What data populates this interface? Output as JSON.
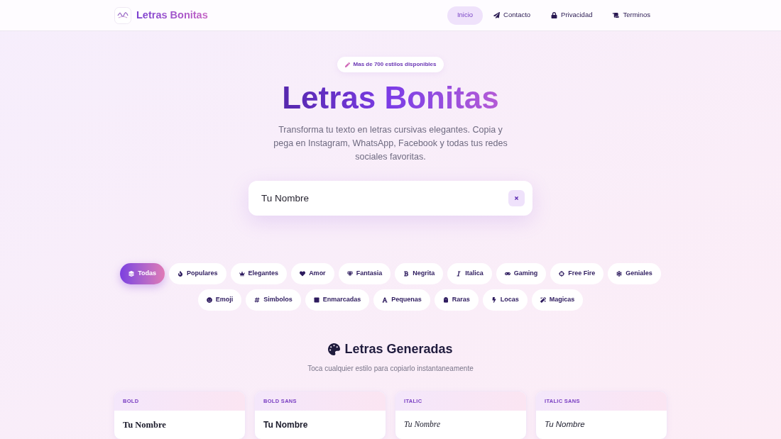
{
  "header": {
    "logo_text": "Letras Bonitas",
    "nav": [
      {
        "label": "Inicio",
        "selected": true
      },
      {
        "label": "Contacto",
        "selected": false
      },
      {
        "label": "Privacidad",
        "selected": false
      },
      {
        "label": "Terminos",
        "selected": false
      }
    ]
  },
  "hero": {
    "badge": "Mas de 700 estilos disponibles",
    "title": "Letras Bonitas",
    "subtitle": "Transforma tu texto en letras cursivas elegantes. Copia y pega en Instagram, WhatsApp, Facebook y todas tus redes sociales favoritas."
  },
  "search": {
    "value": "Tu Nombre"
  },
  "categories": [
    {
      "label": "Todas",
      "selected": true
    },
    {
      "label": "Populares",
      "selected": false
    },
    {
      "label": "Elegantes",
      "selected": false
    },
    {
      "label": "Amor",
      "selected": false
    },
    {
      "label": "Fantasia",
      "selected": false
    },
    {
      "label": "Negrita",
      "selected": false
    },
    {
      "label": "Italica",
      "selected": false
    },
    {
      "label": "Gaming",
      "selected": false
    },
    {
      "label": "Free Fire",
      "selected": false
    },
    {
      "label": "Geniales",
      "selected": false
    },
    {
      "label": "Emoji",
      "selected": false
    },
    {
      "label": "Simbolos",
      "selected": false
    },
    {
      "label": "Enmarcadas",
      "selected": false
    },
    {
      "label": "Pequenas",
      "selected": false
    },
    {
      "label": "Raras",
      "selected": false
    },
    {
      "label": "Locas",
      "selected": false
    },
    {
      "label": "Magicas",
      "selected": false
    }
  ],
  "results": {
    "title": "Letras Generadas",
    "subtitle": "Toca cualquier estilo para copiarlo instantaneamente",
    "cards": [
      {
        "label": "BOLD",
        "kind": "bold",
        "text": "Tu Nombre"
      },
      {
        "label": "BOLD SANS",
        "kind": "bold_sans",
        "text": "Tu Nombre"
      },
      {
        "label": "ITALIC",
        "kind": "italic",
        "text": "Tu Nombre"
      },
      {
        "label": "ITALIC SANS",
        "kind": "italic_sans",
        "text": "Tu Nombre"
      }
    ]
  }
}
